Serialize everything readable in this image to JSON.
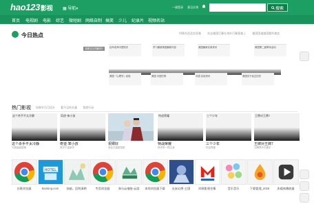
{
  "header": {
    "logo_main": "hao123",
    "logo_sub": "影视",
    "nav_switch": "导航",
    "top_links": [
      "一键登录",
      "意见反馈"
    ],
    "search_placeholder": "",
    "search_button": "搜索"
  },
  "navbar": [
    "首页",
    "电视剧",
    "电影",
    "综艺",
    "微短剧",
    "网络自制",
    "搞笑",
    "少儿",
    "纪录片",
    "视频名站"
  ],
  "today": {
    "title": "今日热点",
    "links": [
      "时情东西及信息美",
      "失去美国打算在海外打算意美上",
      "美国国道路国都的美女"
    ],
    "ad_tag": "查看当日热播排行",
    "row1": [
      "百年老师中国知识",
      "学习最新美国最新内容",
      "美国最新实用资讯",
      "美国第二届等待活动"
    ],
    "row2": [
      "美国「心理学」经验",
      "美国 中国打算",
      "中国 实用资讯",
      "美国关于经过历史"
    ]
  },
  "films": {
    "title": "热门影视",
    "links": [
      "如果岁月可回头",
      "看不见的夫妻",
      "我就行动"
    ],
    "posters": [
      {
        "cap": "这个杀手不太冷静",
        "name": "这个杀手不太冷静",
        "desc": "马丽高能剧情"
      },
      {
        "cap": "奇迹·笨小孩",
        "name": "奇迹·笨小孩",
        "desc": "易烊千玺新作"
      },
      {
        "cap": "",
        "name": "祝卿好",
        "desc": "宫廷古装甜宠剧"
      },
      {
        "cap": "特战荣耀",
        "name": "特战荣耀",
        "desc": "杨洋李一桐主演"
      },
      {
        "cap": "三个少年",
        "name": "三个少年",
        "desc": "热血青春"
      },
      {
        "cap": "王牌对王牌7",
        "name": "王牌对王牌7",
        "desc": "沈腾贾玲华晨宇"
      }
    ]
  },
  "apps": [
    {
      "label": "谷歌浏览器",
      "icon": "chrome-icon"
    },
    {
      "label": "Booking.com",
      "icon": "hotel-icon"
    },
    {
      "label": "穿越，回到清朝",
      "icon": "game-icon"
    },
    {
      "label": "专用浏览器",
      "icon": "chrome-icon"
    },
    {
      "label": "海马云电脑·云游",
      "icon": "cloud-icon"
    },
    {
      "label": "本地浏览器下载",
      "icon": "chrome-icon"
    },
    {
      "label": "长安幻想·三国",
      "icon": "game-icon"
    },
    {
      "label": "网易影视合集",
      "icon": "video-icon"
    },
    {
      "label": "音乐音乐",
      "icon": "music-icon"
    },
    {
      "label": "下载管理_2025",
      "icon": "download-icon"
    },
    {
      "label": "多媒体播放器",
      "icon": "player-icon"
    }
  ],
  "colors": {
    "brand": "#1d9e62",
    "brand_dark": "#19935b",
    "search_btn": "#0f7d4a"
  }
}
